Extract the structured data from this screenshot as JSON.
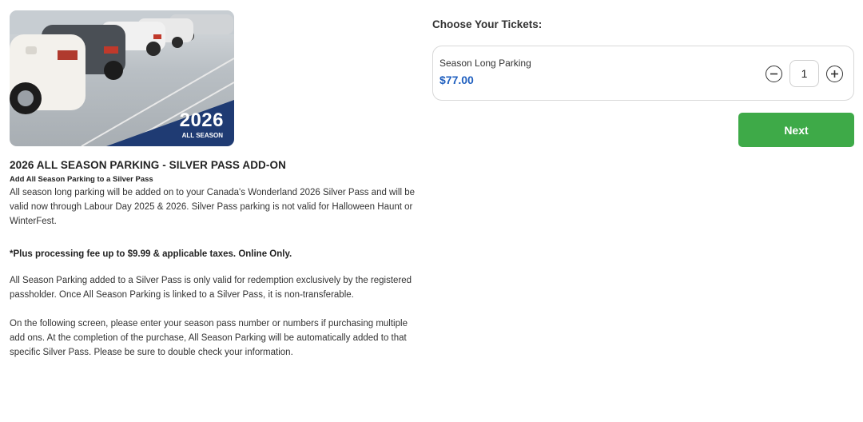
{
  "product": {
    "image_year": "2026",
    "image_subtitle": "ALL SEASON",
    "title": "2026 ALL SEASON PARKING - SILVER PASS ADD-ON",
    "subtitle": "Add All Season Parking to a Silver Pass",
    "paragraph_1": "All season long parking will be added on to your Canada's Wonderland 2026 Silver Pass and will be valid now through Labour Day 2025 & 2026. Silver Pass parking is not valid for Halloween Haunt or WinterFest.",
    "fee_note": "*Plus processing fee up to $9.99 & applicable taxes. Online Only.",
    "paragraph_2": "All Season Parking added to a Silver Pass is only valid for redemption exclusively by the registered passholder. Once All Season Parking is linked to a Silver Pass, it is non-transferable.",
    "paragraph_3": "On the following screen, please enter your season pass number or numbers if purchasing multiple add ons. At the completion of the purchase, All Season Parking will be automatically added to that specific Silver Pass. Please be sure to double check your information."
  },
  "tickets": {
    "heading": "Choose Your Tickets:",
    "items": [
      {
        "name": "Season Long Parking",
        "price": "$77.00",
        "quantity": "1"
      }
    ]
  },
  "actions": {
    "next_label": "Next"
  },
  "colors": {
    "price": "#1f5fbf",
    "next_button": "#3eaa48",
    "badge": "#1f3b73"
  },
  "icons": {
    "decrement": "minus-circle-icon",
    "increment": "plus-circle-icon"
  }
}
